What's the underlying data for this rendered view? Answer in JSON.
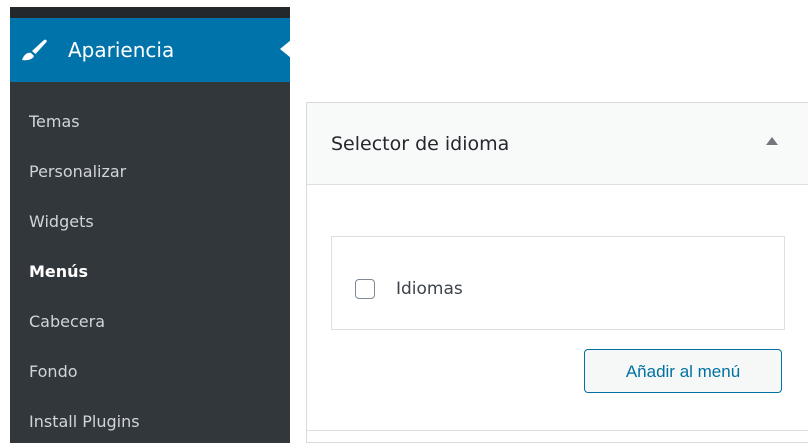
{
  "sidebar": {
    "active_menu": {
      "label": "Apariencia",
      "icon": "paintbrush-icon"
    },
    "submenu": [
      {
        "label": "Temas"
      },
      {
        "label": "Personalizar"
      },
      {
        "label": "Widgets"
      },
      {
        "label": "Menús",
        "current": true
      },
      {
        "label": "Cabecera"
      },
      {
        "label": "Fondo"
      },
      {
        "label": "Install Plugins"
      }
    ]
  },
  "panel": {
    "title": "Selector de idioma",
    "toggle_icon": "triangle-up-icon",
    "items": [
      {
        "label": "Idiomas",
        "checked": false
      }
    ],
    "add_button_label": "Añadir al menú"
  },
  "colors": {
    "sidebar_bg": "#23282d",
    "submenu_bg": "#32373c",
    "active_menu_bg": "#0073aa",
    "button_accent": "#0071a1"
  }
}
